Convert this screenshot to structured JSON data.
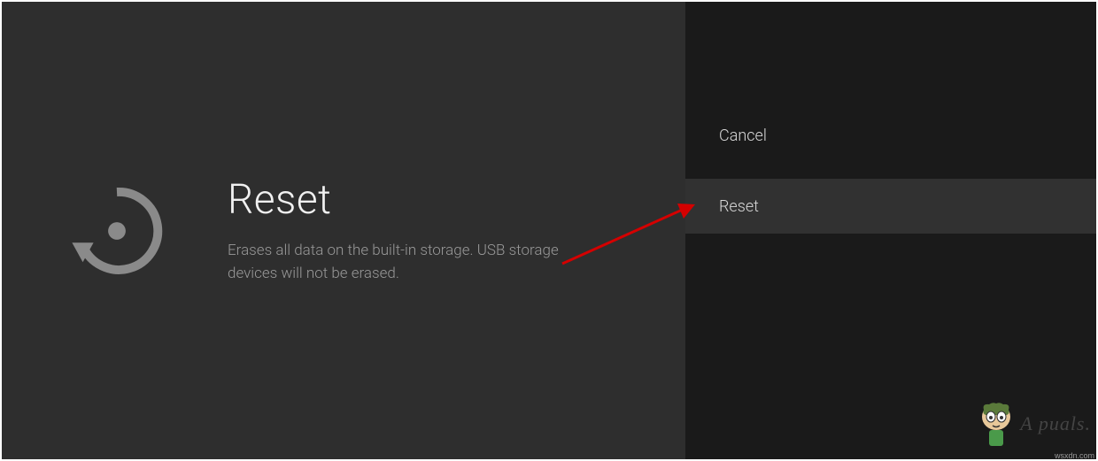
{
  "left": {
    "title": "Reset",
    "description": "Erases all data on the built-in storage. USB storage devices will not be erased."
  },
  "right": {
    "cancel_label": "Cancel",
    "reset_label": "Reset"
  },
  "watermark": {
    "text": "A   puals."
  },
  "source": "wsxdn.com"
}
